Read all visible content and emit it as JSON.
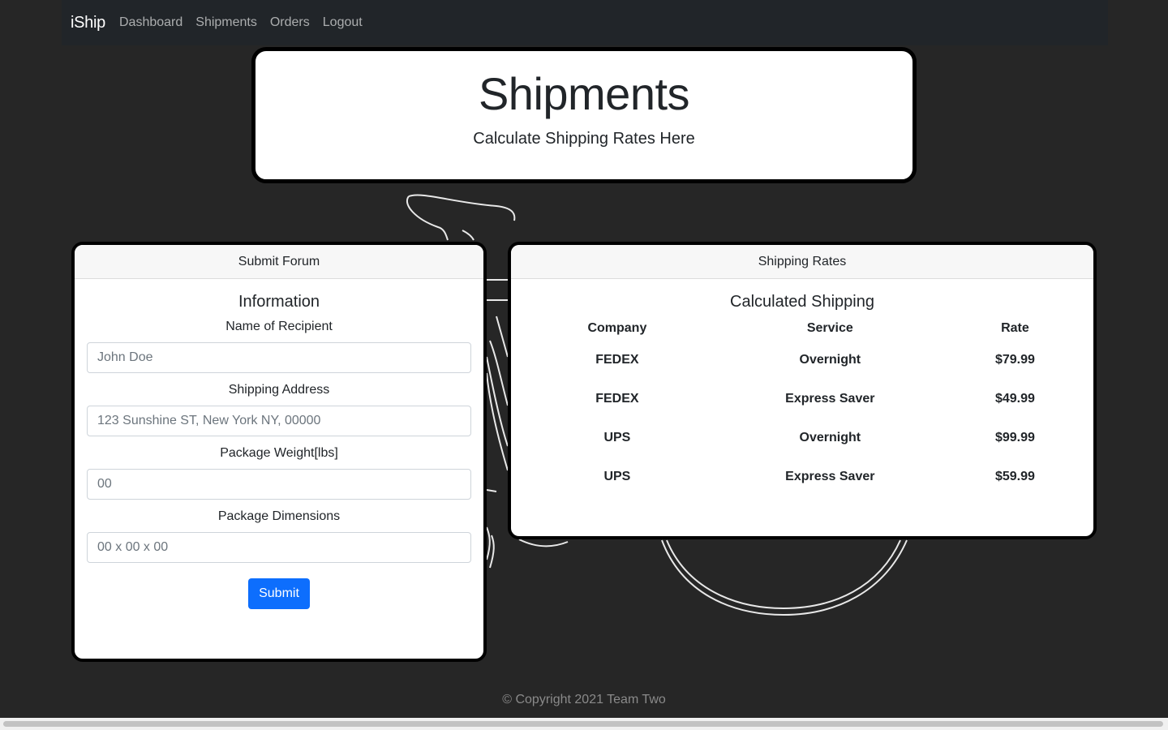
{
  "navbar": {
    "brand": "iShip",
    "links": [
      "Dashboard",
      "Shipments",
      "Orders",
      "Logout"
    ]
  },
  "hero": {
    "title": "Shipments",
    "subtitle": "Calculate Shipping Rates Here"
  },
  "form_card": {
    "header": "Submit Forum",
    "title": "Information",
    "fields": [
      {
        "label": "Name of Recipient",
        "placeholder": "John Doe",
        "value": ""
      },
      {
        "label": "Shipping Address",
        "placeholder": "123 Sunshine ST, New York NY, 00000",
        "value": ""
      },
      {
        "label": "Package Weight[lbs]",
        "placeholder": "00",
        "value": ""
      },
      {
        "label": "Package Dimensions",
        "placeholder": "00 x 00 x 00",
        "value": ""
      }
    ],
    "submit_label": "Submit"
  },
  "rates_card": {
    "header": "Shipping Rates",
    "title": "Calculated Shipping",
    "columns": [
      "Company",
      "Service",
      "Rate"
    ],
    "rows": [
      [
        "FEDEX",
        "Overnight",
        "$79.99"
      ],
      [
        "FEDEX",
        "Express Saver",
        "$49.99"
      ],
      [
        "UPS",
        "Overnight",
        "$99.99"
      ],
      [
        "UPS",
        "Express Saver",
        "$59.99"
      ]
    ]
  },
  "footer": {
    "text": "© Copyright 2021 Team Two"
  },
  "colors": {
    "background": "#262626",
    "navbar": "#212529",
    "primary_button": "#0d6efd",
    "card_border": "#000000"
  }
}
